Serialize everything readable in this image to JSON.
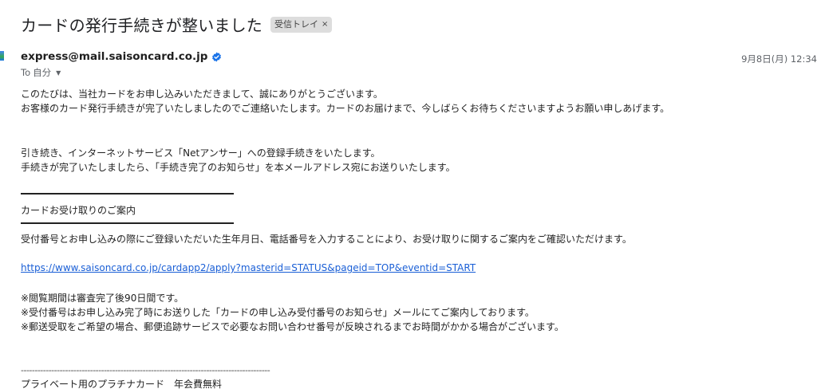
{
  "email": {
    "subject": "カードの発行手続きが整いました",
    "label_chip": "受信トレイ",
    "label_chip_close": "×",
    "sender": "express@mail.saisoncard.co.jp",
    "date": "9月8日(月) 12:34",
    "to_prefix": "To",
    "to_name": "自分",
    "body": {
      "p1_line1": "このたびは、当社カードをお申し込みいただきまして、誠にありがとうございます。",
      "p1_line2": "お客様のカード発行手続きが完了いたしましたのでご連絡いたします。カードのお届けまで、今しばらくお待ちくださいますようお願い申しあげます。",
      "p2_line1": "引き続き、インターネットサービス「Netアンサー」への登録手続きをいたします。",
      "p2_line2": "手続きが完了いたしましたら、「手続き完了のお知らせ」を本メールアドレス宛にお送りいたします。",
      "section_title": "カードお受け取りのご案内",
      "p3": "受付番号とお申し込みの際にご登録いただいた生年月日、電話番号を入力することにより、お受け取りに関するご案内をご確認いただけます。",
      "link": "https://www.saisoncard.co.jp/cardapp2/apply?masterid=STATUS&pageid=TOP&eventid=START",
      "note1": "※閲覧期間は審査完了後90日間です。",
      "note2": "※受付番号はお申し込み完了時にお送りした「カードの申し込み受付番号のお知らせ」メールにてご案内しております。",
      "note3": "※郵送受取をご希望の場合、郵便追跡サービスで必要なお問い合わせ番号が反映されるまでお時間がかかる場合がございます。",
      "dashes": "------------------------------------------------------------------------------------------",
      "footer_line": " プライベート用のプラチナカード　年会費無料"
    }
  }
}
